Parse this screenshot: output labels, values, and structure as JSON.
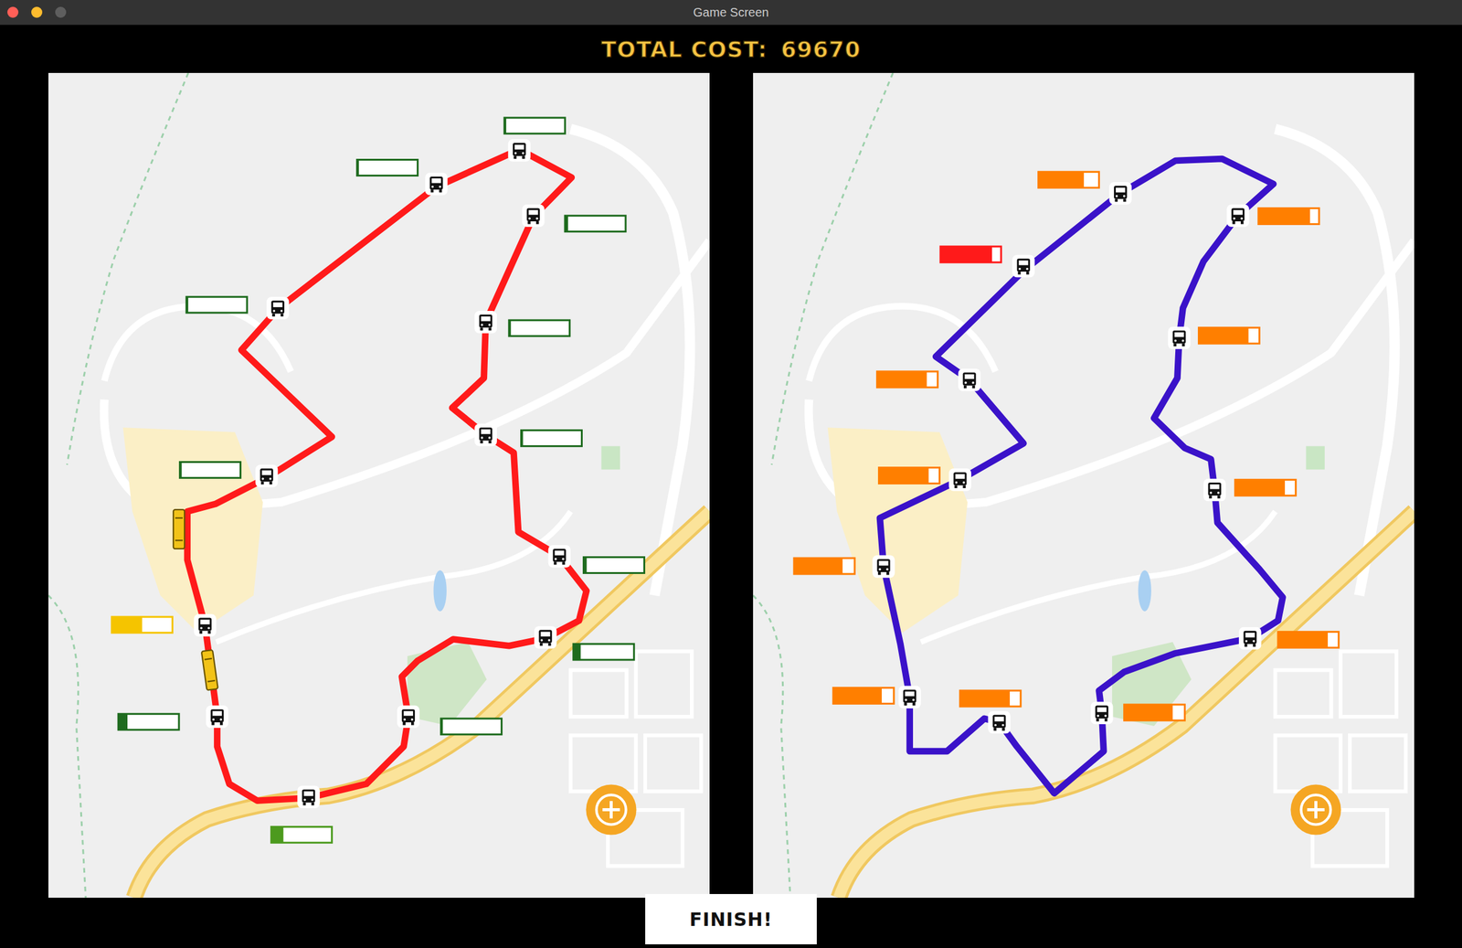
{
  "window": {
    "title": "Game Screen",
    "controls": [
      {
        "color": "#ff5f57"
      },
      {
        "color": "#febc2e"
      },
      {
        "color": "#5e5e5e"
      }
    ]
  },
  "total_cost": {
    "label": "TOTAL COST:",
    "value": "69670"
  },
  "maps": [
    {
      "route_color": "#ff1a1a",
      "bus_count": 2,
      "stops": [
        {
          "level": 0.03,
          "color": "#1e6b1e"
        },
        {
          "level": 0.03,
          "color": "#1e6b1e"
        },
        {
          "level": 0.05,
          "color": "#1e6b1e"
        },
        {
          "level": 0.03,
          "color": "#1e6b1e"
        },
        {
          "level": 0.03,
          "color": "#1e6b1e"
        },
        {
          "level": 0.03,
          "color": "#1e6b1e"
        },
        {
          "level": 0.03,
          "color": "#1e6b1e"
        },
        {
          "level": 0.05,
          "color": "#1e6b1e"
        },
        {
          "level": 0.12,
          "color": "#1e6b1e"
        },
        {
          "level": 0.5,
          "color": "#f5c400"
        },
        {
          "level": 0.15,
          "color": "#1e6b1e"
        },
        {
          "level": 0.03,
          "color": "#1e6b1e"
        },
        {
          "level": 0.2,
          "color": "#4c9a1e"
        }
      ]
    },
    {
      "route_color": "#3a12c9",
      "bus_count": 0,
      "stops": [
        {
          "level": 0.75,
          "color": "#ff7f00"
        },
        {
          "level": 0.85,
          "color": "#ff7f00"
        },
        {
          "level": 0.85,
          "color": "#ff1a1a"
        },
        {
          "level": 0.82,
          "color": "#ff7f00"
        },
        {
          "level": 0.82,
          "color": "#ff7f00"
        },
        {
          "level": 0.82,
          "color": "#ff7f00"
        },
        {
          "level": 0.82,
          "color": "#ff7f00"
        },
        {
          "level": 0.8,
          "color": "#ff7f00"
        },
        {
          "level": 0.82,
          "color": "#ff7f00"
        },
        {
          "level": 0.8,
          "color": "#ff7f00"
        },
        {
          "level": 0.82,
          "color": "#ff7f00"
        },
        {
          "level": 0.8,
          "color": "#ff7f00"
        }
      ]
    }
  ],
  "finish_button": {
    "label": "FINISH!"
  }
}
